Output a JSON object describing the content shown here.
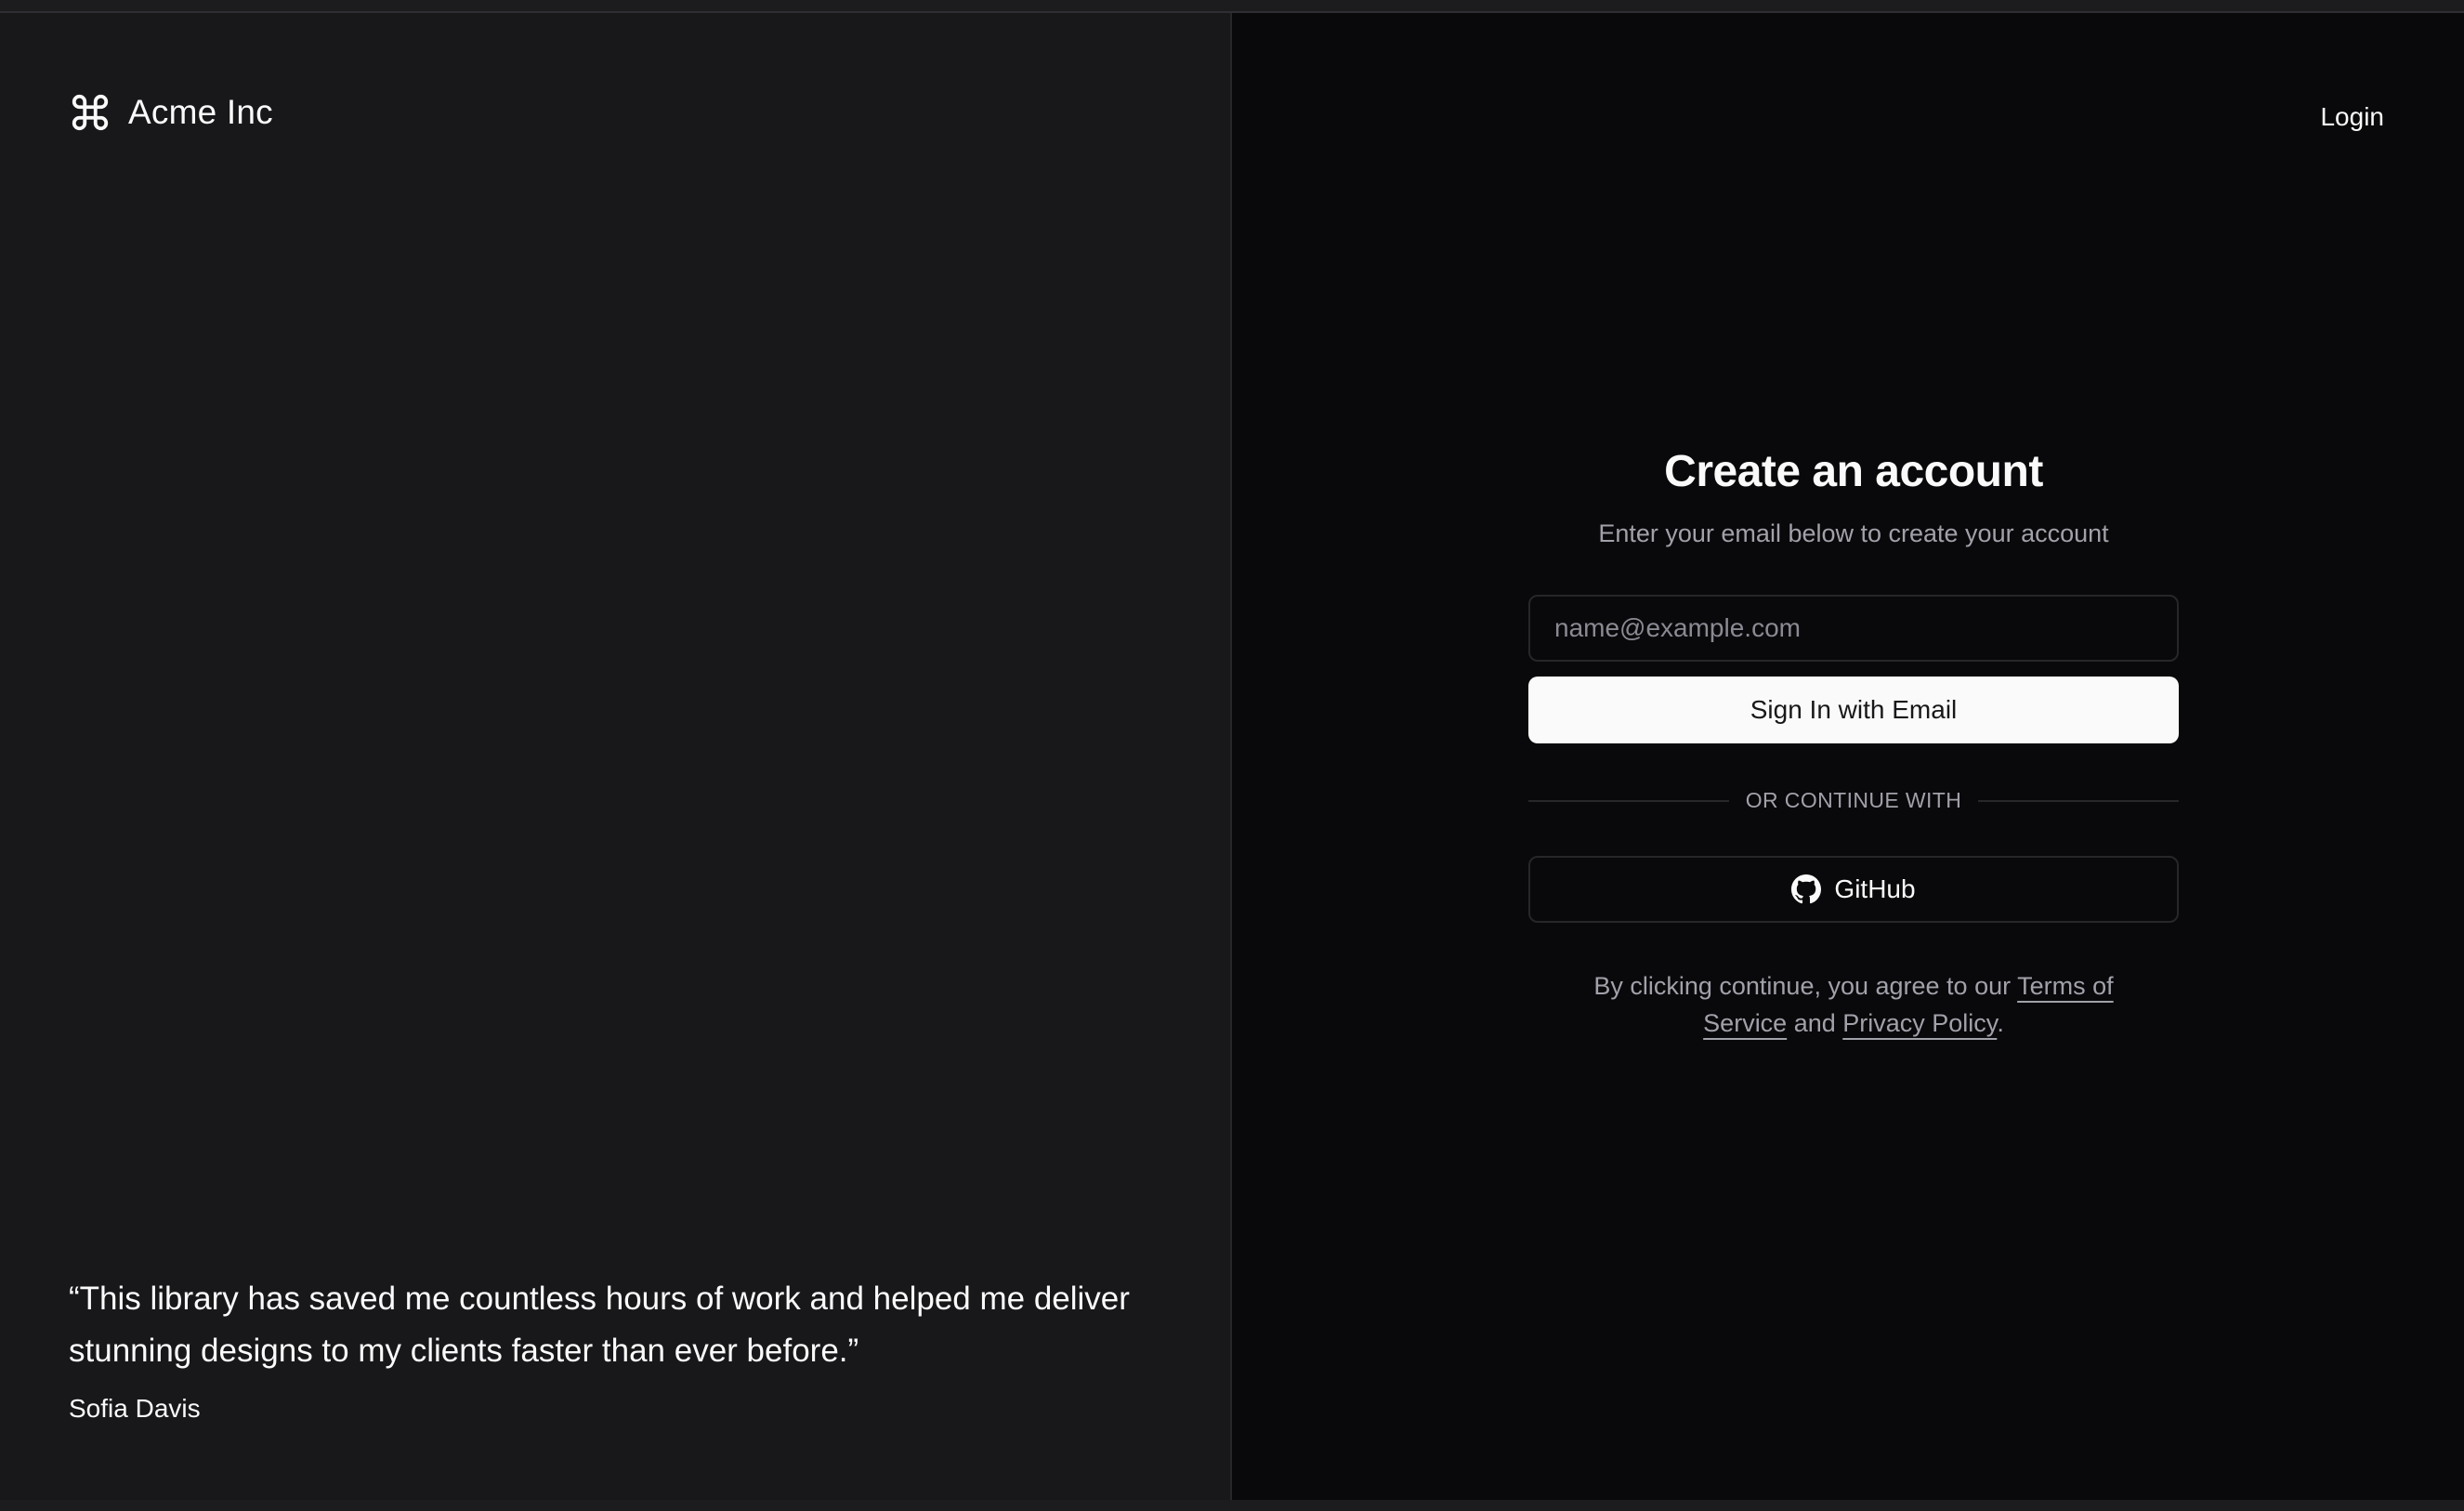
{
  "brand": {
    "name": "Acme Inc",
    "icon": "command-icon"
  },
  "nav": {
    "login_label": "Login"
  },
  "testimonial": {
    "quote": "“This library has saved me countless hours of work and helped me deliver stunning designs to my clients faster than ever before.”",
    "author": "Sofia Davis"
  },
  "form": {
    "title": "Create an account",
    "subtitle": "Enter your email below to create your account",
    "email_placeholder": "name@example.com",
    "submit_label": "Sign In with Email",
    "divider_label": "OR CONTINUE WITH",
    "github_label": "GitHub",
    "github_icon": "github-icon"
  },
  "legal": {
    "prefix": "By clicking continue, you agree to our ",
    "terms_label": "Terms of Service",
    "middle": " and ",
    "privacy_label": "Privacy Policy",
    "suffix": "."
  },
  "colors": {
    "left_panel_bg": "#18181b",
    "right_panel_bg": "#09090b",
    "border": "#27272a",
    "foreground": "#fafafa",
    "muted": "#a1a1aa",
    "primary_button_bg": "#fafafa"
  }
}
